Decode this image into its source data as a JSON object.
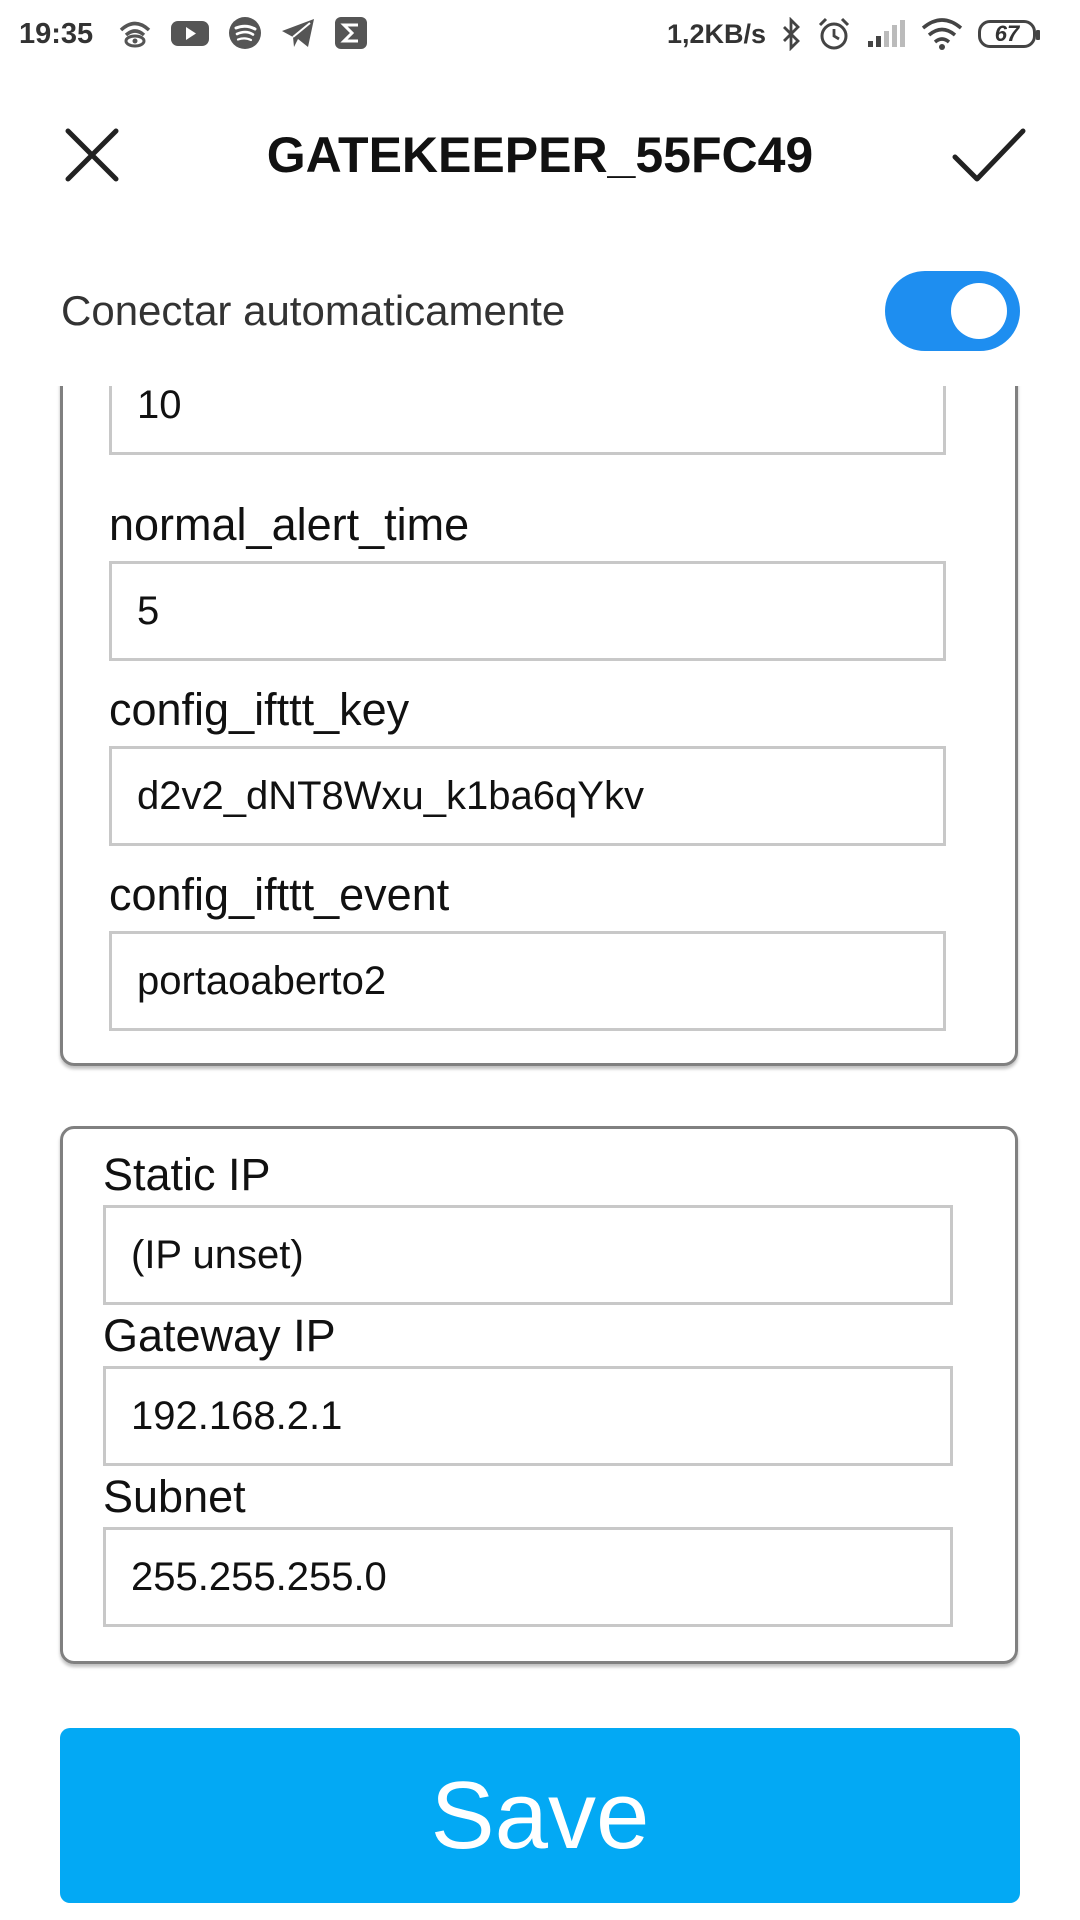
{
  "status_bar": {
    "time": "19:35",
    "net_rate": "1,2KB/s",
    "battery": "67",
    "left_icons": [
      "wifi-eye-icon",
      "youtube-icon",
      "spotify-icon",
      "telegram-icon",
      "sigma-icon"
    ],
    "right_icons": [
      "bluetooth-icon",
      "alarm-icon",
      "signal-icon",
      "wifi-icon",
      "battery-icon"
    ]
  },
  "header": {
    "title": "GATEKEEPER_55FC49"
  },
  "auto_connect": {
    "label": "Conectar automaticamente",
    "enabled": true,
    "accent": "#1e8ef0"
  },
  "config": {
    "partial_value": "10",
    "fields": [
      {
        "label": "normal_alert_time",
        "value": "5"
      },
      {
        "label": "config_ifttt_key",
        "value": "d2v2_dNT8Wxu_k1ba6qYkv"
      },
      {
        "label": "config_ifttt_event",
        "value": "portaoaberto2"
      }
    ]
  },
  "network": {
    "fields": [
      {
        "label": "Static IP",
        "value": "(IP unset)"
      },
      {
        "label": "Gateway IP",
        "value": "192.168.2.1"
      },
      {
        "label": "Subnet",
        "value": "255.255.255.0"
      }
    ]
  },
  "save": {
    "label": "Save",
    "color": "#03a9f4"
  }
}
